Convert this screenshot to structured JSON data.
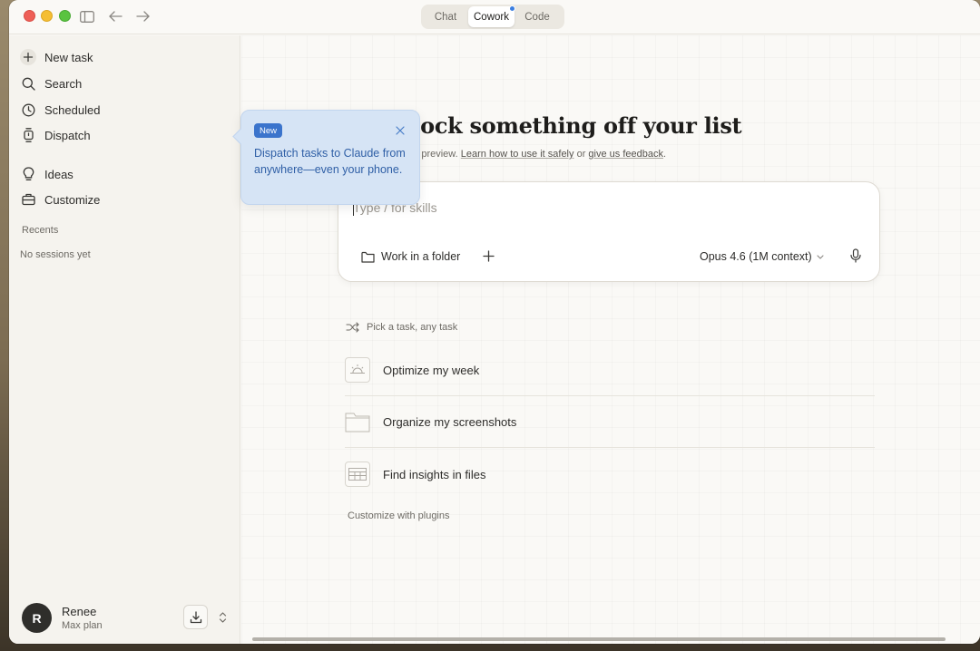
{
  "window": {
    "mode_tabs": [
      {
        "label": "Chat",
        "active": false
      },
      {
        "label": "Cowork",
        "active": true,
        "has_notification_dot": true
      },
      {
        "label": "Code",
        "active": false
      }
    ]
  },
  "sidebar": {
    "items": [
      {
        "label": "New task",
        "icon": "plus-icon"
      },
      {
        "label": "Search",
        "icon": "search-icon"
      },
      {
        "label": "Scheduled",
        "icon": "clock-icon"
      },
      {
        "label": "Dispatch",
        "icon": "phone-watch-icon"
      },
      {
        "label": "Ideas",
        "icon": "lightbulb-icon"
      },
      {
        "label": "Customize",
        "icon": "briefcase-icon"
      }
    ],
    "recents_label": "Recents",
    "empty_sessions": "No sessions yet",
    "user": {
      "initial": "R",
      "name": "Renee",
      "plan": "Max plan"
    }
  },
  "main": {
    "headline": "nock something off your list",
    "subline": {
      "prefix": "rch preview.",
      "link1": "Learn how to use it safely",
      "middle": "or",
      "link2": "give us feedback",
      "suffix": "."
    },
    "composer": {
      "placeholder": "Type / for skills",
      "folder_label": "Work in a folder",
      "model_label": "Opus 4.6 (1M context)"
    },
    "pick_label": "Pick a task, any task",
    "tasks": [
      {
        "label": "Optimize my week",
        "icon": "sun-calendar-icon"
      },
      {
        "label": "Organize my screenshots",
        "icon": "folder-icon"
      },
      {
        "label": "Find insights in files",
        "icon": "spreadsheet-icon"
      }
    ],
    "plugins_label": "Customize with plugins"
  },
  "popover": {
    "badge": "New",
    "text": "Dispatch tasks to Claude from anywhere—even your phone."
  },
  "colors": {
    "accent_blue": "#3b74cc",
    "popover_bg": "#d6e4f5",
    "popover_text": "#2f5fa6",
    "window_bg": "#faf9f6",
    "sidebar_bg": "#f5f3ee"
  }
}
